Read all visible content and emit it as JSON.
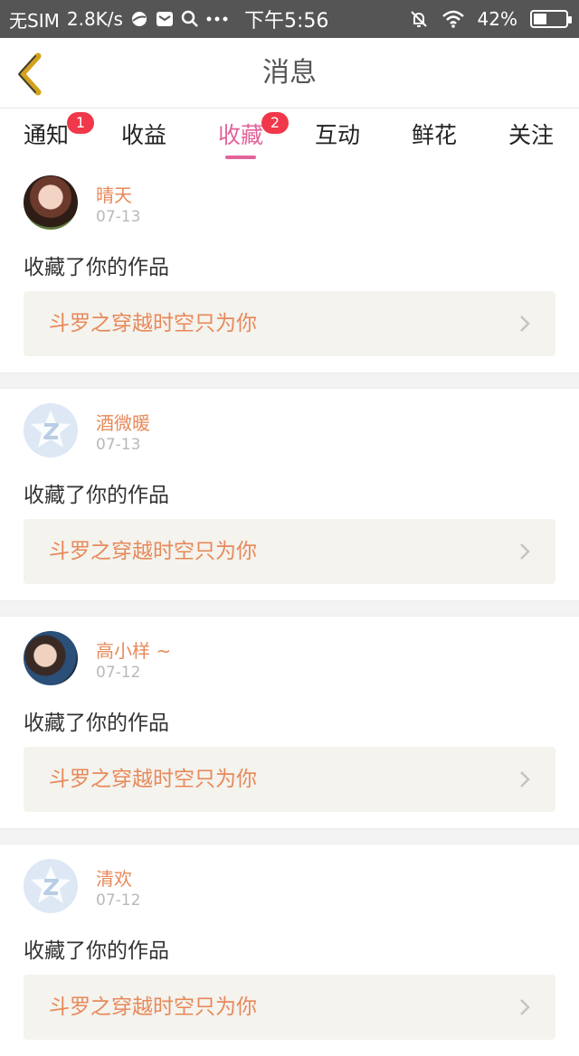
{
  "status_bar": {
    "carrier": "无SIM",
    "speed": "2.8K/s",
    "time": "下午5:56",
    "battery": "42%",
    "battery_level": 0.42,
    "icons": [
      "browser-icon",
      "mail-icon",
      "search-icon",
      "more-icon",
      "alarm-off-icon",
      "wifi-icon",
      "battery-icon"
    ]
  },
  "header": {
    "title": "消息",
    "back_icon": "chevron-left-icon"
  },
  "tabs": [
    {
      "label": "通知",
      "badge": "1",
      "active": false
    },
    {
      "label": "收益",
      "badge": "",
      "active": false
    },
    {
      "label": "收藏",
      "badge": "2",
      "active": true
    },
    {
      "label": "互动",
      "badge": "",
      "active": false
    },
    {
      "label": "鲜花",
      "badge": "",
      "active": false
    },
    {
      "label": "关注",
      "badge": "",
      "active": false
    }
  ],
  "feed": [
    {
      "name": "晴天",
      "date": "07-13",
      "action": "收藏了你的作品",
      "work": "斗罗之穿越时空只为你",
      "avatar": "photo-avatar"
    },
    {
      "name": "酒微暖",
      "date": "07-13",
      "action": "收藏了你的作品",
      "work": "斗罗之穿越时空只为你",
      "avatar": "default-avatar"
    },
    {
      "name": "高小样 ~",
      "date": "07-12",
      "action": "收藏了你的作品",
      "work": "斗罗之穿越时空只为你",
      "avatar": "photo-avatar"
    },
    {
      "name": "清欢",
      "date": "07-12",
      "action": "收藏了你的作品",
      "work": "斗罗之穿越时空只为你",
      "avatar": "default-avatar"
    }
  ],
  "colors": {
    "accent": "#e2649b",
    "name": "#e7895a",
    "badge": "#f0384a",
    "back": "#d3a21a"
  }
}
